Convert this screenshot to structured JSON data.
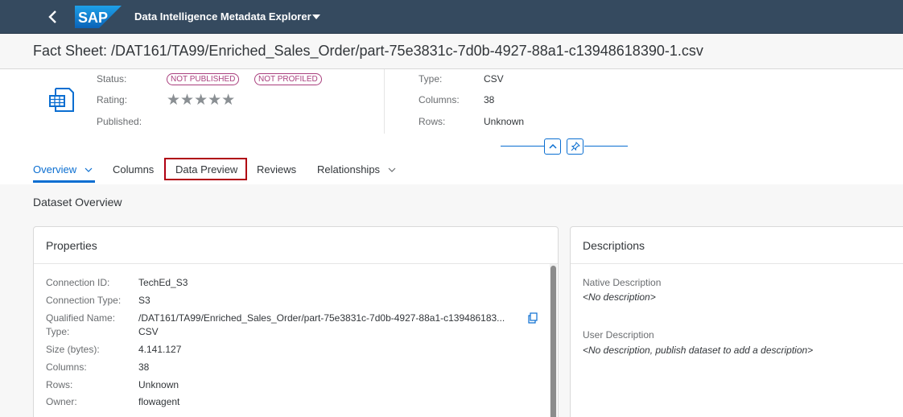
{
  "shell": {
    "logo_text": "SAP",
    "app_title": "Data Intelligence Metadata Explorer",
    "brand_color": "#354a5f"
  },
  "header": {
    "title": "Fact Sheet: /DAT161/TA99/Enriched_Sales_Order/part-75e3831c-7d0b-4927-88a1-c13948618390-1.csv"
  },
  "object": {
    "status_label": "Status:",
    "status_badges": [
      "NOT PUBLISHED",
      "NOT PROFILED"
    ],
    "rating_label": "Rating:",
    "rating_stars": "★★★★★",
    "rating_value": 0,
    "published_label": "Published:",
    "published_value": "",
    "type_label": "Type:",
    "type_value": "CSV",
    "columns_label": "Columns:",
    "columns_value": "38",
    "rows_label": "Rows:",
    "rows_value": "Unknown"
  },
  "tabs": [
    {
      "label": "Overview",
      "active": true,
      "has_menu": true
    },
    {
      "label": "Columns",
      "active": false,
      "has_menu": false
    },
    {
      "label": "Data Preview",
      "active": false,
      "has_menu": false,
      "highlighted": true
    },
    {
      "label": "Reviews",
      "active": false,
      "has_menu": false
    },
    {
      "label": "Relationships",
      "active": false,
      "has_menu": true
    }
  ],
  "content": {
    "section_title": "Dataset Overview",
    "properties": {
      "title": "Properties",
      "rows": [
        {
          "label": "Connection ID:",
          "value": "TechEd_S3"
        },
        {
          "label": "Connection Type:",
          "value": "S3"
        },
        {
          "label": "Qualified Name:",
          "value": "/DAT161/TA99/Enriched_Sales_Order/part-75e3831c-7d0b-4927-88a1-c139486183..."
        },
        {
          "label": "Type:",
          "value": "CSV"
        },
        {
          "label": "Size (bytes):",
          "value": "4.141.127"
        },
        {
          "label": "Columns:",
          "value": "38"
        },
        {
          "label": "Rows:",
          "value": "Unknown"
        },
        {
          "label": "Owner:",
          "value": "flowagent"
        }
      ]
    },
    "descriptions": {
      "title": "Descriptions",
      "native_label": "Native Description",
      "native_value": "<No description>",
      "user_label": "User Description",
      "user_value": "<No description, publish dataset to add a description>"
    }
  }
}
